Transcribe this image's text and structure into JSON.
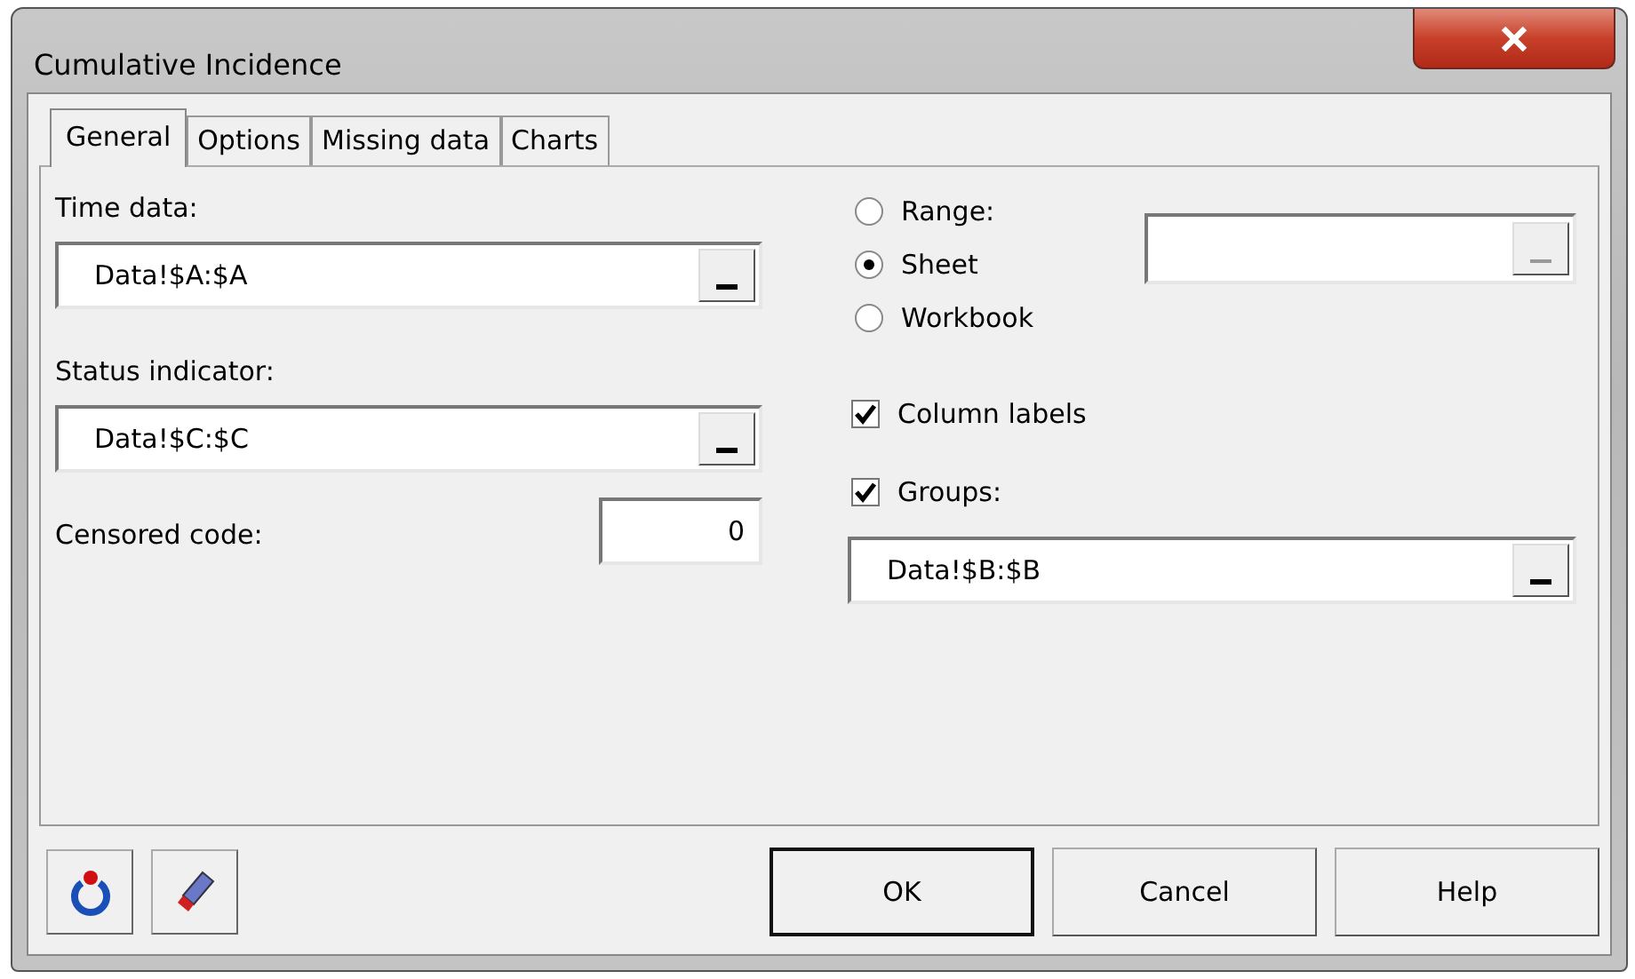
{
  "window": {
    "title": "Cumulative Incidence"
  },
  "tabs": [
    {
      "label": "General",
      "selected": true
    },
    {
      "label": "Options",
      "selected": false
    },
    {
      "label": "Missing data",
      "selected": false
    },
    {
      "label": "Charts",
      "selected": false
    }
  ],
  "fields": [
    {
      "label": "Time data:",
      "value": "Data!$A:$A"
    },
    {
      "label": "Status indicator:",
      "value": "Data!$C:$C"
    }
  ],
  "censored_code": {
    "label": "Censored code:",
    "value": "0"
  },
  "sources": [
    {
      "label": "Range:",
      "selected": false
    },
    {
      "label": "Sheet",
      "selected": true
    },
    {
      "label": "Workbook",
      "selected": false
    }
  ],
  "checkboxes": [
    {
      "label": "Column labels",
      "checked": true
    },
    {
      "label": "Groups:",
      "checked": true
    }
  ],
  "groups_field": {
    "value": "Data!$B:$B"
  },
  "buttons": [
    {
      "label": "OK",
      "default": true
    },
    {
      "label": "Cancel",
      "default": false
    },
    {
      "label": "Help",
      "default": false
    }
  ]
}
